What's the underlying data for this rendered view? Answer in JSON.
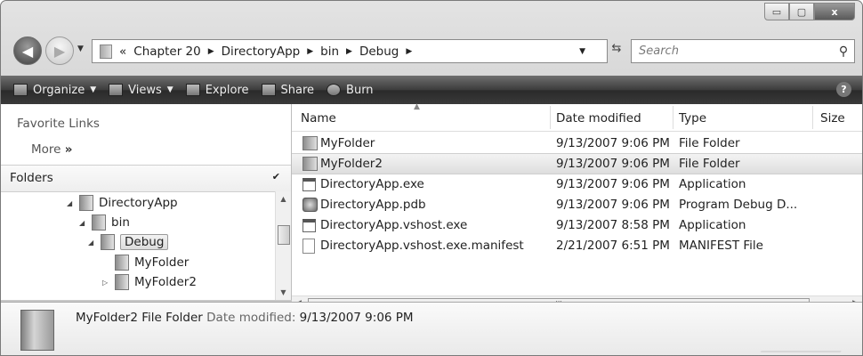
{
  "window": {
    "caption_min": "▭",
    "caption_max": "▢",
    "caption_close": "x"
  },
  "address": {
    "overflow": "«",
    "crumbs": [
      "Chapter 20",
      "DirectoryApp",
      "bin",
      "Debug"
    ],
    "separator": "▶",
    "search_placeholder": "Search"
  },
  "toolbar": {
    "organize": "Organize",
    "views": "Views",
    "explore": "Explore",
    "share": "Share",
    "burn": "Burn",
    "help": "?"
  },
  "left": {
    "favorite_links": "Favorite Links",
    "more": "More",
    "more_glyph": "»",
    "folders": "Folders",
    "tree": [
      {
        "label": "DirectoryApp",
        "twisty": "◢"
      },
      {
        "label": "bin",
        "twisty": "◢"
      },
      {
        "label": "Debug",
        "twisty": "◢"
      },
      {
        "label": "MyFolder",
        "twisty": ""
      },
      {
        "label": "MyFolder2",
        "twisty": "▷"
      }
    ]
  },
  "list": {
    "columns": [
      "Name",
      "Date modified",
      "Type",
      "Size"
    ],
    "rows": [
      {
        "name": "MyFolder",
        "date": "9/13/2007 9:06 PM",
        "type": "File Folder",
        "icon": "folder-icon"
      },
      {
        "name": "MyFolder2",
        "date": "9/13/2007 9:06 PM",
        "type": "File Folder",
        "icon": "folder-icon"
      },
      {
        "name": "DirectoryApp.exe",
        "date": "9/13/2007 9:06 PM",
        "type": "Application",
        "icon": "application-icon"
      },
      {
        "name": "DirectoryApp.pdb",
        "date": "9/13/2007 9:06 PM",
        "type": "Program Debug D...",
        "icon": "pdb-file-icon"
      },
      {
        "name": "DirectoryApp.vshost.exe",
        "date": "9/13/2007 8:58 PM",
        "type": "Application",
        "icon": "application-icon"
      },
      {
        "name": "DirectoryApp.vshost.exe.manifest",
        "date": "2/21/2007 6:51 PM",
        "type": "MANIFEST File",
        "icon": "file-icon"
      }
    ],
    "selected_index": 1,
    "hscroll_grip": "III"
  },
  "details": {
    "name": "MyFolder2",
    "type": "File Folder",
    "date_label": "Date modified:",
    "date": "9/13/2007 9:06 PM"
  }
}
